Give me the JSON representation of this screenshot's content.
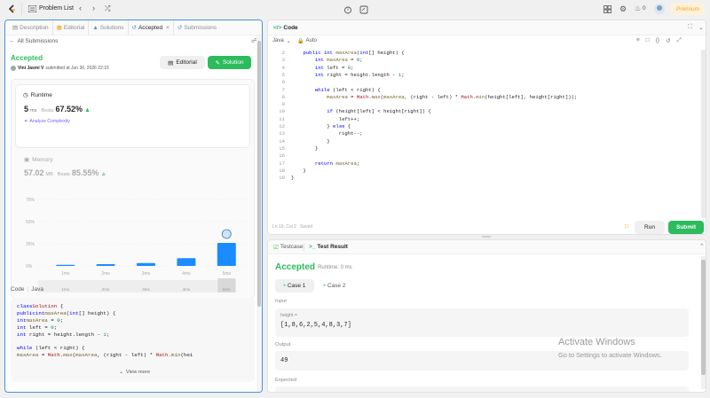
{
  "topbar": {
    "problem_list": "Problem List",
    "points": "0",
    "premium": "Premium"
  },
  "left_tabs": [
    {
      "label": "Description"
    },
    {
      "label": "Editorial"
    },
    {
      "label": "Solutions"
    },
    {
      "label": "Accepted"
    },
    {
      "label": "Submissions"
    }
  ],
  "submission": {
    "back_label": "All Submissions",
    "status": "Accepted",
    "user": "Vini Jasmi V",
    "submitted_at": "submitted at Jun 30, 2026 22:15",
    "editorial_btn": "Editorial",
    "solution_btn": "Solution",
    "runtime_label": "Runtime",
    "runtime_value": "5",
    "runtime_unit": "ms",
    "beats_label": "Beats",
    "runtime_beats": "67.52%",
    "analyze": "Analyze Complexity",
    "memory_label": "Memory",
    "memory_value": "57.02",
    "memory_unit": "MB",
    "memory_beats": "85.55%"
  },
  "chart_data": {
    "type": "bar",
    "categories": [
      "1ms",
      "2ms",
      "3ms",
      "4ms",
      "5ms"
    ],
    "values": [
      1.2,
      2.0,
      3.2,
      8.8,
      26.0
    ],
    "ytick_labels": [
      "75%",
      "50%",
      "25%",
      "0%"
    ],
    "ylim": [
      0,
      75
    ],
    "xlabel": "",
    "ylabel": "",
    "mini_labels": [
      "1ms",
      "2ms",
      "3ms",
      "4ms",
      "6ms"
    ],
    "highlight": "5ms"
  },
  "code_preview": {
    "header": "Code",
    "lang": "Java",
    "lines": [
      "class Solution {",
      "    public int maxArea(int[] height) {",
      "        int maxArea = 0;",
      "        int left = 0;",
      "        int right = height.length - 1;",
      "",
      "        while (left < right) {",
      "            maxArea = Math.max(maxArea, (right - left) * Math.min(hei"
    ],
    "view_more": "View more"
  },
  "editor": {
    "title": "Code",
    "lang": "Java",
    "mode": "Auto",
    "lines": [
      {
        "n": "2",
        "t": "    public int maxArea(int[] height) {"
      },
      {
        "n": "3",
        "t": "        int maxArea = 0;"
      },
      {
        "n": "4",
        "t": "        int left = 0;"
      },
      {
        "n": "5",
        "t": "        int right = height.length - 1;"
      },
      {
        "n": "6",
        "t": ""
      },
      {
        "n": "7",
        "t": "        while (left < right) {"
      },
      {
        "n": "8",
        "t": "            maxArea = Math.max(maxArea, (right - left) * Math.min(height[left], height[right]));"
      },
      {
        "n": "9",
        "t": ""
      },
      {
        "n": "10",
        "t": "            if (height[left] < height[right]) {"
      },
      {
        "n": "11",
        "t": "                left++;"
      },
      {
        "n": "12",
        "t": "            } else {"
      },
      {
        "n": "13",
        "t": "                right--;"
      },
      {
        "n": "14",
        "t": "            }"
      },
      {
        "n": "15",
        "t": "        }"
      },
      {
        "n": "16",
        "t": ""
      },
      {
        "n": "17",
        "t": "        return maxArea;"
      },
      {
        "n": "18",
        "t": "    }"
      },
      {
        "n": "19",
        "t": "}"
      }
    ],
    "status": "Ln 19, Col 2",
    "saved": "Saved",
    "run": "Run",
    "submit": "Submit"
  },
  "result": {
    "tab_testcase": "Testcase",
    "tab_result": "Test Result",
    "status": "Accepted",
    "runtime": "Runtime: 0 ms",
    "cases": [
      "Case 1",
      "Case 2"
    ],
    "input_label": "Input",
    "input_var": "height =",
    "input_val": "[1,8,6,2,5,4,8,3,7]",
    "output_label": "Output",
    "output_val": "49",
    "expected_label": "Expected"
  },
  "watermark": {
    "line1": "Activate Windows",
    "line2": "Go to Settings to activate Windows."
  },
  "colors": {
    "accent": "#2cbb5d",
    "bar": "#1a8cff",
    "premium": "#ffa116"
  }
}
